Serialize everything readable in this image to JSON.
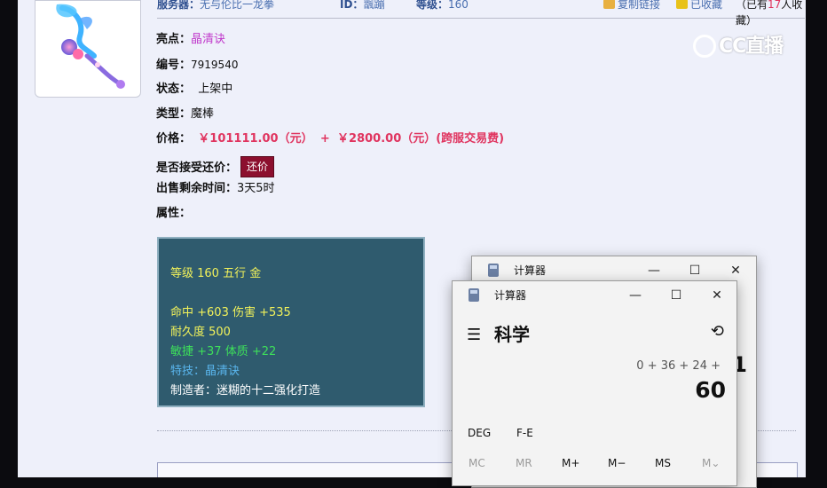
{
  "header": {
    "server_label": "服务器：",
    "server_value": "无与伦比一龙拳",
    "id_label": "ID：",
    "id_value": "飁蹦",
    "level_label": "等级：",
    "level_value": "160",
    "copy_link": "复制链接",
    "favorited": "已收藏",
    "favorite_count_prefix": "（已有",
    "favorite_count": "17",
    "favorite_count_suffix": "人收藏）"
  },
  "item": {
    "highlight_label": "亮点：",
    "highlight_value": "晶清诀",
    "number_label": "编号：",
    "number_value": "7919540",
    "status_label": "状态：",
    "status_value": "上架中",
    "type_label": "类型：",
    "type_value": "魔棒",
    "price_label": "价格：",
    "price_value": "￥101111.00（元）",
    "price_plus": "+",
    "fee_value": "￥2800.00（元）(跨服交易费)",
    "bargain_label": "是否接受还价：",
    "bargain_button": "还价",
    "remaining_label": "出售剩余时间：",
    "remaining_value": "3天5时",
    "attributes_label": "属性："
  },
  "attributes": {
    "line1": "等级 160 五行 金",
    "line2": "命中 +603 伤害 +535",
    "line3": "耐久度 500",
    "line4": "敏捷 +37 体质 +22",
    "line5": "特技：晶清诀",
    "line6": "制造者：迷糊的十二强化打造"
  },
  "watermark": "CC直播",
  "calculator_back": {
    "title": "计算器",
    "partial_result": "1",
    "minimize": "—",
    "maximize": "☐",
    "close": "✕"
  },
  "calculator": {
    "title": "计算器",
    "minimize": "—",
    "maximize": "☐",
    "close": "✕",
    "menu": "☰",
    "mode": "科学",
    "history": "⟲",
    "expression": "0 + 36 + 24 +",
    "result": "60",
    "deg": "DEG",
    "fe": "F-E",
    "mc": "MC",
    "mr": "MR",
    "mplus": "M+",
    "mminus": "M−",
    "ms": "MS",
    "mdown": "M⌄"
  },
  "colors": {
    "attr_bg": "#2f5b6e",
    "accent_magenta": "#c03acb",
    "price_red": "#e0345f",
    "bargain_bg": "#8c0f2e"
  }
}
